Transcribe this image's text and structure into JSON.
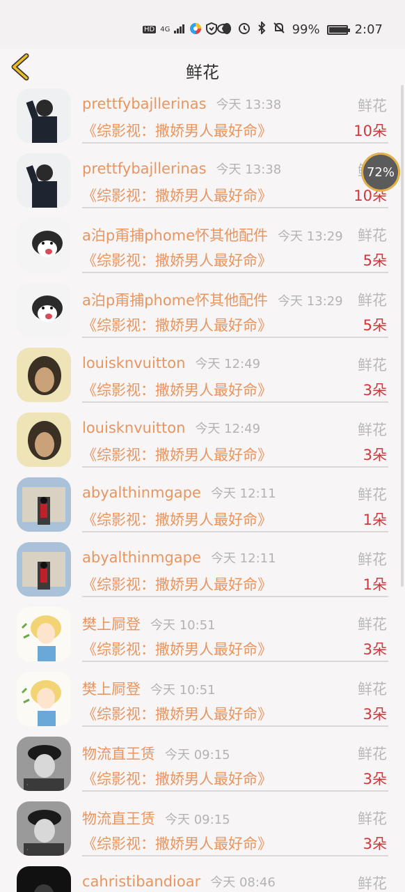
{
  "statusbar": {
    "hd": "HD",
    "signal": "4G",
    "battery_pct": "99%",
    "time": "2:07",
    "battery_level": 0.99
  },
  "header": {
    "title": "鲜花"
  },
  "floating": {
    "label": "72%"
  },
  "rows": [
    {
      "name": "prettfybajllerinas",
      "time": "今天 13:38",
      "gift": "鲜花",
      "book": "《综影视：撒娇男人最好命》",
      "count": "10朵",
      "avatar": "avatar-black-hoodie"
    },
    {
      "name": "prettfybajllerinas",
      "time": "今天 13:38",
      "gift": "鲜花",
      "book": "《综影视：撒娇男人最好命》",
      "count": "10朵",
      "avatar": "avatar-black-hoodie"
    },
    {
      "name": "a泊p甭捕phome怀其他配件",
      "time": "今天 13:29",
      "gift": "鲜花",
      "book": "《综影视：撒娇男人最好命》",
      "count": "5朵",
      "avatar": "avatar-husky"
    },
    {
      "name": "a泊p甭捕phome怀其他配件",
      "time": "今天 13:29",
      "gift": "鲜花",
      "book": "《综影视：撒娇男人最好命》",
      "count": "5朵",
      "avatar": "avatar-husky"
    },
    {
      "name": "louisknvuitton",
      "time": "今天 12:49",
      "gift": "鲜花",
      "book": "《综影视：撒娇男人最好命》",
      "count": "3朵",
      "avatar": "avatar-bob-hair"
    },
    {
      "name": "louisknvuitton",
      "time": "今天 12:49",
      "gift": "鲜花",
      "book": "《综影视：撒娇男人最好命》",
      "count": "3朵",
      "avatar": "avatar-bob-hair"
    },
    {
      "name": "abyalthinmgape",
      "time": "今天 12:11",
      "gift": "鲜花",
      "book": "《综影视：撒娇男人最好命》",
      "count": "1朵",
      "avatar": "avatar-guard"
    },
    {
      "name": "abyalthinmgape",
      "time": "今天 12:11",
      "gift": "鲜花",
      "book": "《综影视：撒娇男人最好命》",
      "count": "1朵",
      "avatar": "avatar-guard"
    },
    {
      "name": "樊上屙登",
      "time": "今天 10:51",
      "gift": "鲜花",
      "book": "《综影视：撒娇男人最好命》",
      "count": "3朵",
      "avatar": "avatar-anime"
    },
    {
      "name": "樊上屙登",
      "time": "今天 10:51",
      "gift": "鲜花",
      "book": "《综影视：撒娇男人最好命》",
      "count": "3朵",
      "avatar": "avatar-anime"
    },
    {
      "name": "物流直王赁",
      "time": "今天 09:15",
      "gift": "鲜花",
      "book": "《综影视：撒娇男人最好命》",
      "count": "3朵",
      "avatar": "avatar-bw-boy"
    },
    {
      "name": "物流直王赁",
      "time": "今天 09:15",
      "gift": "鲜花",
      "book": "《综影视：撒娇男人最好命》",
      "count": "3朵",
      "avatar": "avatar-bw-boy"
    },
    {
      "name": "cahristibandioar",
      "time": "今天 08:46",
      "gift": "鲜花",
      "book": "",
      "count": "",
      "avatar": "avatar-dark"
    }
  ]
}
